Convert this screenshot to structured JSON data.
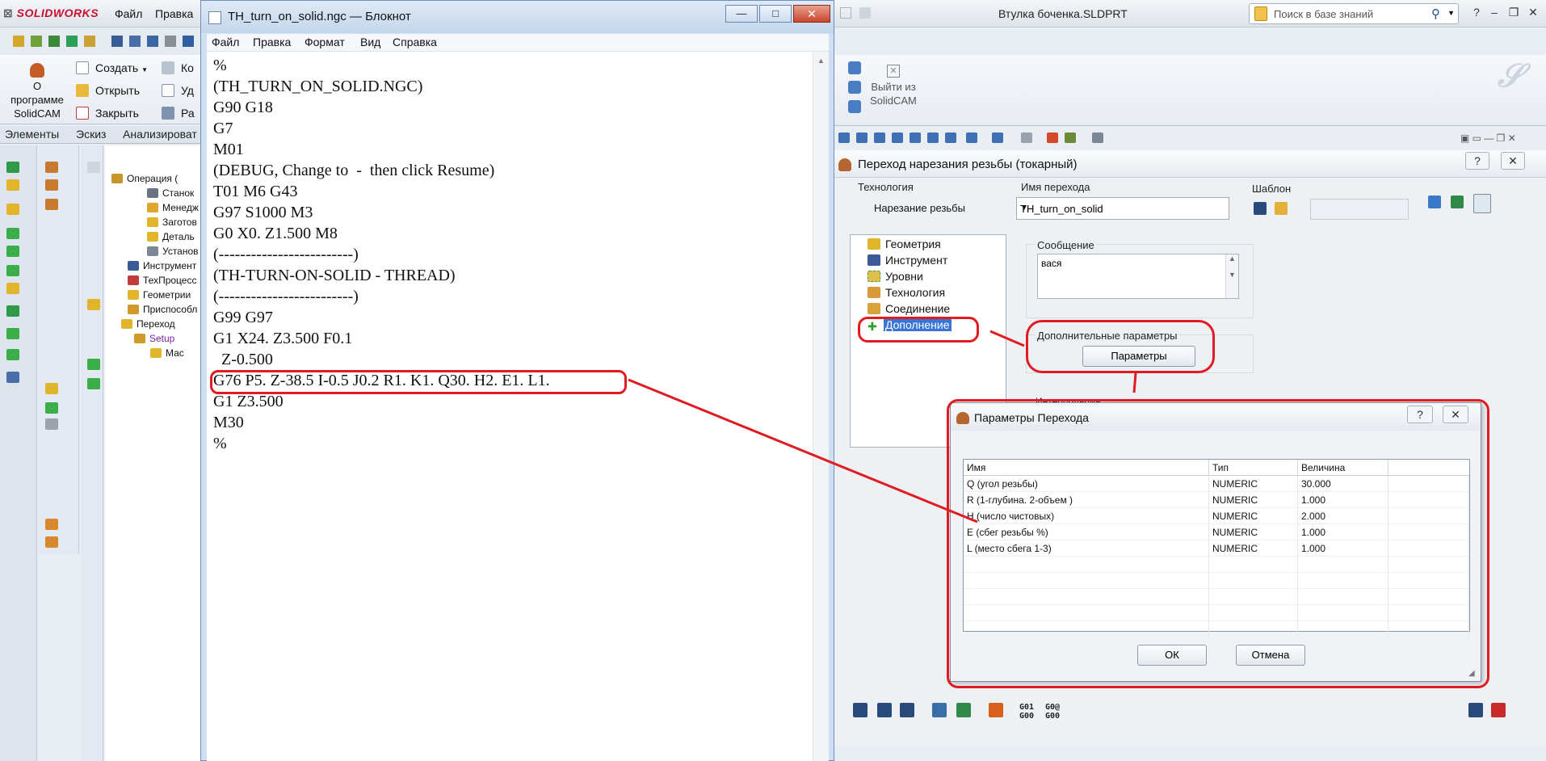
{
  "solidworks": {
    "logo": "SOLIDWORKS",
    "menu": [
      "Файл",
      "Правка"
    ],
    "document_title": "Втулка боченка.SLDPRT",
    "search_placeholder": "Поиск в базе знаний",
    "about_button": "О программе SolidCAM",
    "ribbon_items": [
      "Создать",
      "Открыть",
      "Закрыть"
    ],
    "ribbon_items_truncated": [
      "Ко",
      "Уд",
      "Ра"
    ],
    "tabs": [
      "Элементы",
      "Эскиз",
      "Анализироват"
    ],
    "exit_button": "Выйти из SolidCAM",
    "tree": {
      "operation": "Операция (",
      "machine": "Станок",
      "manager": "Менедж",
      "stock": "Заготов",
      "part": "Деталь",
      "setup_item": "Установ",
      "tools": "Инструмент",
      "tech_process": "ТехПроцесс",
      "geometries": "Геометрии",
      "fixtures": "Приспособл",
      "operations": "Переход",
      "setup": "Setup",
      "sub": "Мас"
    }
  },
  "notepad": {
    "title": "TH_turn_on_solid.ngc — Блокнот",
    "menu": [
      "Файл",
      "Правка",
      "Формат",
      "Вид",
      "Справка"
    ],
    "minimize": "—",
    "maximize": "□",
    "close": "✕",
    "lines": [
      "%",
      "(TH_TURN_ON_SOLID.NGC)",
      "G90 G18",
      "G7",
      "M01",
      "(DEBUG, Change to  -  then click Resume)",
      "T01 M6 G43",
      "G97 S1000 M3",
      "G0 X0. Z1.500 M8",
      "(-------------------------)",
      "(TH-TURN-ON-SOLID - THREAD)",
      "(-------------------------)",
      "G99 G97",
      "G1 X24. Z3.500 F0.1",
      "  Z-0.500",
      "G76 P5. Z-38.5 I-0.5 J0.2 R1. K1. Q30. H2. E1. L1.",
      "G1 Z3.500",
      "M30",
      "%"
    ]
  },
  "solidcam_dialog": {
    "title": "Переход нарезания резьбы (токарный)",
    "help": "?",
    "close": "✕",
    "technology_label": "Технология",
    "technology_value": "Нарезание резьбы",
    "op_name_label": "Имя перехода",
    "op_name_value": "TH_turn_on_solid",
    "template_label": "Шаблон",
    "tree": [
      "Геометрия",
      "Инструмент",
      "Уровни",
      "Технология",
      "Соединение",
      "Дополнение"
    ],
    "message_label": "Сообщение",
    "message_value": "вася",
    "extra_params_label": "Дополнительные параметры",
    "params_button": "Параметры",
    "interpolation_label": "Интерполяция"
  },
  "params_dialog": {
    "title": "Параметры Перехода",
    "help": "?",
    "close": "✕",
    "columns": [
      "Имя",
      "Тип",
      "Величина"
    ],
    "rows": [
      {
        "name": "Q (угол резьбы)",
        "type": "NUMERIC",
        "value": "30.000"
      },
      {
        "name": "R (1-глубина. 2-объем )",
        "type": "NUMERIC",
        "value": "1.000"
      },
      {
        "name": "H (число чистовых)",
        "type": "NUMERIC",
        "value": "2.000"
      },
      {
        "name": "E (сбег резьбы %)",
        "type": "NUMERIC",
        "value": "1.000"
      },
      {
        "name": "L (место сбега 1-3)",
        "type": "NUMERIC",
        "value": "1.000"
      }
    ],
    "ok": "ОК",
    "cancel": "Отмена"
  },
  "bottom_toolbar": {
    "g01": "G01\nG00",
    "g0": "G0@\nG00"
  },
  "colors": {
    "annotation_red": "#e11b22",
    "selection_blue": "#3875d7"
  }
}
